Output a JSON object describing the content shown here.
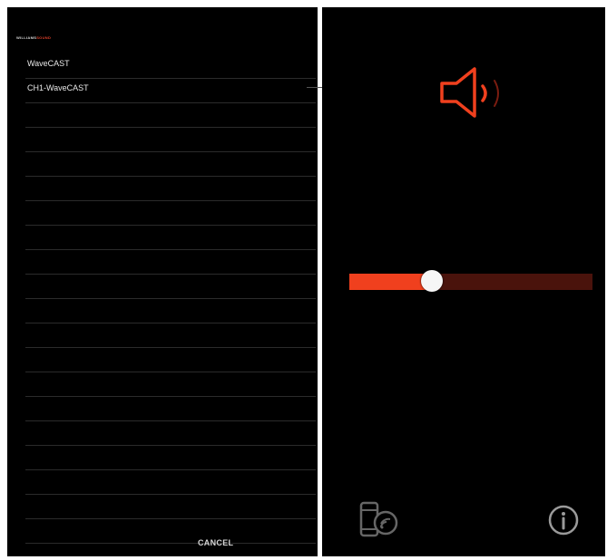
{
  "brand": {
    "part1": "WILLIAMS",
    "part2": "SOUND"
  },
  "devices": [
    {
      "label": "WaveCAST"
    },
    {
      "label": "CH1-WaveCAST"
    },
    {
      "label": ""
    },
    {
      "label": ""
    },
    {
      "label": ""
    },
    {
      "label": ""
    },
    {
      "label": ""
    },
    {
      "label": ""
    },
    {
      "label": ""
    },
    {
      "label": ""
    },
    {
      "label": ""
    },
    {
      "label": ""
    },
    {
      "label": ""
    },
    {
      "label": ""
    },
    {
      "label": ""
    },
    {
      "label": ""
    },
    {
      "label": ""
    },
    {
      "label": ""
    },
    {
      "label": ""
    },
    {
      "label": ""
    }
  ],
  "cancel_label": "CANCEL",
  "volume": {
    "level": 0.34
  },
  "colors": {
    "accent": "#f0401e",
    "track": "#4a130c",
    "background": "#000000"
  },
  "icons": {
    "speaker": "speaker-volume-icon",
    "cast": "phone-cast-icon",
    "info": "info-icon"
  }
}
